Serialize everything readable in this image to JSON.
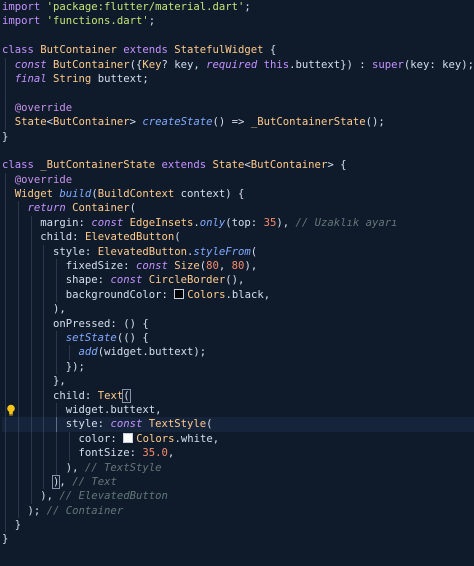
{
  "editor": {
    "background": "#0f1a2b",
    "current_line": 29,
    "lines": [
      {
        "tokens": [
          {
            "t": "import ",
            "c": "kw"
          },
          {
            "t": "'package:flutter/material.dart'",
            "c": "str"
          },
          {
            "t": ";",
            "c": "pl"
          }
        ]
      },
      {
        "tokens": [
          {
            "t": "import ",
            "c": "kw"
          },
          {
            "t": "'functions.dart'",
            "c": "str"
          },
          {
            "t": ";",
            "c": "pl"
          }
        ]
      },
      {
        "tokens": []
      },
      {
        "tokens": [
          {
            "t": "class ",
            "c": "kw"
          },
          {
            "t": "ButContainer ",
            "c": "cls"
          },
          {
            "t": "extends ",
            "c": "kw"
          },
          {
            "t": "StatefulWidget ",
            "c": "cls"
          },
          {
            "t": "{",
            "c": "pl"
          }
        ]
      },
      {
        "guides": [
          0
        ],
        "tokens": [
          {
            "t": "  ",
            "c": "pl"
          },
          {
            "t": "const ",
            "c": "kwi"
          },
          {
            "t": "ButContainer",
            "c": "cls"
          },
          {
            "t": "({",
            "c": "pl"
          },
          {
            "t": "Key",
            "c": "cls"
          },
          {
            "t": "? ",
            "c": "pl"
          },
          {
            "t": "key",
            "c": "pl"
          },
          {
            "t": ", ",
            "c": "pl"
          },
          {
            "t": "required ",
            "c": "kwi"
          },
          {
            "t": "this",
            "c": "kw"
          },
          {
            "t": ".buttext",
            "c": "pl"
          },
          {
            "t": "}) : ",
            "c": "pl"
          },
          {
            "t": "super",
            "c": "kw"
          },
          {
            "t": "(key: key);",
            "c": "pl"
          }
        ]
      },
      {
        "guides": [
          0
        ],
        "tokens": [
          {
            "t": "  ",
            "c": "pl"
          },
          {
            "t": "final ",
            "c": "kwi"
          },
          {
            "t": "String ",
            "c": "cls"
          },
          {
            "t": "buttext;",
            "c": "pl"
          }
        ]
      },
      {
        "guides": [
          0
        ],
        "tokens": []
      },
      {
        "guides": [
          0
        ],
        "tokens": [
          {
            "t": "  ",
            "c": "pl"
          },
          {
            "t": "@override",
            "c": "ann"
          }
        ]
      },
      {
        "guides": [
          0
        ],
        "tokens": [
          {
            "t": "  ",
            "c": "pl"
          },
          {
            "t": "State",
            "c": "cls"
          },
          {
            "t": "<",
            "c": "pl"
          },
          {
            "t": "ButContainer",
            "c": "cls"
          },
          {
            "t": "> ",
            "c": "pl"
          },
          {
            "t": "createState",
            "c": "fn"
          },
          {
            "t": "() => ",
            "c": "pl"
          },
          {
            "t": "_ButContainerState",
            "c": "cls"
          },
          {
            "t": "();",
            "c": "pl"
          }
        ]
      },
      {
        "tokens": [
          {
            "t": "}",
            "c": "pl"
          }
        ]
      },
      {
        "tokens": []
      },
      {
        "tokens": [
          {
            "t": "class ",
            "c": "kw"
          },
          {
            "t": "_ButContainerState ",
            "c": "cls"
          },
          {
            "t": "extends ",
            "c": "kw"
          },
          {
            "t": "State",
            "c": "cls"
          },
          {
            "t": "<",
            "c": "pl"
          },
          {
            "t": "ButContainer",
            "c": "cls"
          },
          {
            "t": "> {",
            "c": "pl"
          }
        ]
      },
      {
        "guides": [
          0
        ],
        "tokens": [
          {
            "t": "  ",
            "c": "pl"
          },
          {
            "t": "@override",
            "c": "ann"
          }
        ]
      },
      {
        "guides": [
          0
        ],
        "tokens": [
          {
            "t": "  ",
            "c": "pl"
          },
          {
            "t": "Widget ",
            "c": "cls"
          },
          {
            "t": "build",
            "c": "fn"
          },
          {
            "t": "(",
            "c": "pl"
          },
          {
            "t": "BuildContext ",
            "c": "cls"
          },
          {
            "t": "context) {",
            "c": "pl"
          }
        ]
      },
      {
        "guides": [
          0,
          1
        ],
        "tokens": [
          {
            "t": "    ",
            "c": "pl"
          },
          {
            "t": "return ",
            "c": "kwi"
          },
          {
            "t": "Container",
            "c": "cls"
          },
          {
            "t": "(",
            "c": "pl"
          }
        ]
      },
      {
        "guides": [
          0,
          1,
          2
        ],
        "tokens": [
          {
            "t": "      ",
            "c": "pl"
          },
          {
            "t": "margin: ",
            "c": "pl"
          },
          {
            "t": "const ",
            "c": "kwi"
          },
          {
            "t": "EdgeInsets",
            "c": "cls"
          },
          {
            "t": ".",
            "c": "pl"
          },
          {
            "t": "only",
            "c": "fn"
          },
          {
            "t": "(top: ",
            "c": "pl"
          },
          {
            "t": "35",
            "c": "num"
          },
          {
            "t": "), ",
            "c": "pl"
          },
          {
            "t": "// Uzaklık ayarı",
            "c": "cmt"
          }
        ]
      },
      {
        "guides": [
          0,
          1,
          2
        ],
        "tokens": [
          {
            "t": "      ",
            "c": "pl"
          },
          {
            "t": "child: ",
            "c": "pl"
          },
          {
            "t": "ElevatedButton",
            "c": "cls"
          },
          {
            "t": "(",
            "c": "pl"
          }
        ]
      },
      {
        "guides": [
          0,
          1,
          2,
          3
        ],
        "tokens": [
          {
            "t": "        ",
            "c": "pl"
          },
          {
            "t": "style: ",
            "c": "pl"
          },
          {
            "t": "ElevatedButton",
            "c": "cls"
          },
          {
            "t": ".",
            "c": "pl"
          },
          {
            "t": "styleFrom",
            "c": "fn"
          },
          {
            "t": "(",
            "c": "pl"
          }
        ]
      },
      {
        "guides": [
          0,
          1,
          2,
          3,
          4
        ],
        "tokens": [
          {
            "t": "          ",
            "c": "pl"
          },
          {
            "t": "fixedSize: ",
            "c": "pl"
          },
          {
            "t": "const ",
            "c": "kwi"
          },
          {
            "t": "Size",
            "c": "cls"
          },
          {
            "t": "(",
            "c": "pl"
          },
          {
            "t": "80",
            "c": "num"
          },
          {
            "t": ", ",
            "c": "pl"
          },
          {
            "t": "80",
            "c": "num"
          },
          {
            "t": "),",
            "c": "pl"
          }
        ]
      },
      {
        "guides": [
          0,
          1,
          2,
          3,
          4
        ],
        "tokens": [
          {
            "t": "          ",
            "c": "pl"
          },
          {
            "t": "shape: ",
            "c": "pl"
          },
          {
            "t": "const ",
            "c": "kwi"
          },
          {
            "t": "CircleBorder",
            "c": "cls"
          },
          {
            "t": "(),",
            "c": "pl"
          }
        ]
      },
      {
        "guides": [
          0,
          1,
          2,
          3,
          4
        ],
        "tokens": [
          {
            "t": "          ",
            "c": "pl"
          },
          {
            "t": "backgroundColor: ",
            "c": "pl"
          },
          {
            "swatch": "#000000"
          },
          {
            "t": "Colors",
            "c": "cls"
          },
          {
            "t": ".black,",
            "c": "pl"
          }
        ]
      },
      {
        "guides": [
          0,
          1,
          2,
          3
        ],
        "tokens": [
          {
            "t": "        ",
            "c": "pl"
          },
          {
            "t": "),",
            "c": "pl"
          }
        ]
      },
      {
        "guides": [
          0,
          1,
          2,
          3
        ],
        "tokens": [
          {
            "t": "        ",
            "c": "pl"
          },
          {
            "t": "onPressed: ",
            "c": "pl"
          },
          {
            "t": "() {",
            "c": "pl"
          }
        ]
      },
      {
        "guides": [
          0,
          1,
          2,
          3,
          4
        ],
        "tokens": [
          {
            "t": "          ",
            "c": "pl"
          },
          {
            "t": "setState",
            "c": "fn"
          },
          {
            "t": "(() {",
            "c": "pl"
          }
        ]
      },
      {
        "guides": [
          0,
          1,
          2,
          3,
          4,
          5
        ],
        "tokens": [
          {
            "t": "            ",
            "c": "pl"
          },
          {
            "t": "add",
            "c": "fn"
          },
          {
            "t": "(widget.buttext);",
            "c": "pl"
          }
        ]
      },
      {
        "guides": [
          0,
          1,
          2,
          3,
          4
        ],
        "tokens": [
          {
            "t": "          ",
            "c": "pl"
          },
          {
            "t": "});",
            "c": "pl"
          }
        ]
      },
      {
        "guides": [
          0,
          1,
          2,
          3
        ],
        "tokens": [
          {
            "t": "        ",
            "c": "pl"
          },
          {
            "t": "},",
            "c": "pl"
          }
        ]
      },
      {
        "guides": [
          0,
          1,
          2,
          3
        ],
        "tokens": [
          {
            "t": "        ",
            "c": "pl"
          },
          {
            "t": "child: ",
            "c": "pl"
          },
          {
            "t": "Text",
            "c": "cls"
          },
          {
            "t": "(",
            "c": "pl",
            "match": true
          }
        ]
      },
      {
        "guides": [
          0,
          1,
          2,
          3,
          4
        ],
        "bulb": true,
        "tokens": [
          {
            "t": "          ",
            "c": "pl"
          },
          {
            "t": "widget.buttext,",
            "c": "pl"
          }
        ]
      },
      {
        "guides": [
          0,
          1,
          2,
          3,
          4
        ],
        "tokens": [
          {
            "t": "          ",
            "c": "pl"
          },
          {
            "t": "style: ",
            "c": "pl"
          },
          {
            "t": "const ",
            "c": "kwi"
          },
          {
            "t": "TextStyle",
            "c": "cls"
          },
          {
            "t": "(",
            "c": "pl"
          }
        ]
      },
      {
        "guides": [
          0,
          1,
          2,
          3,
          4,
          5
        ],
        "tokens": [
          {
            "t": "            ",
            "c": "pl"
          },
          {
            "t": "color: ",
            "c": "pl"
          },
          {
            "swatch": "#ffffff"
          },
          {
            "t": "Colors",
            "c": "cls"
          },
          {
            "t": ".white,",
            "c": "pl"
          }
        ]
      },
      {
        "guides": [
          0,
          1,
          2,
          3,
          4,
          5
        ],
        "tokens": [
          {
            "t": "            ",
            "c": "pl"
          },
          {
            "t": "fontSize: ",
            "c": "pl"
          },
          {
            "t": "35.0",
            "c": "num"
          },
          {
            "t": ",",
            "c": "pl"
          }
        ]
      },
      {
        "guides": [
          0,
          1,
          2,
          3,
          4
        ],
        "tokens": [
          {
            "t": "          ",
            "c": "pl"
          },
          {
            "t": "), ",
            "c": "pl"
          },
          {
            "t": "// TextStyle",
            "c": "cmt"
          }
        ]
      },
      {
        "guides": [
          0,
          1,
          2,
          3
        ],
        "tokens": [
          {
            "t": "        ",
            "c": "pl"
          },
          {
            "t": ")",
            "c": "pl",
            "match": true
          },
          {
            "t": ", ",
            "c": "pl"
          },
          {
            "t": "// Text",
            "c": "cmt"
          }
        ]
      },
      {
        "guides": [
          0,
          1,
          2
        ],
        "tokens": [
          {
            "t": "      ",
            "c": "pl"
          },
          {
            "t": "), ",
            "c": "pl"
          },
          {
            "t": "// ElevatedButton",
            "c": "cmt"
          }
        ]
      },
      {
        "guides": [
          0,
          1
        ],
        "tokens": [
          {
            "t": "    ",
            "c": "pl"
          },
          {
            "t": "); ",
            "c": "pl"
          },
          {
            "t": "// Container",
            "c": "cmt"
          }
        ]
      },
      {
        "guides": [
          0
        ],
        "tokens": [
          {
            "t": "  ",
            "c": "pl"
          },
          {
            "t": "}",
            "c": "pl"
          }
        ]
      },
      {
        "tokens": [
          {
            "t": "}",
            "c": "pl"
          }
        ]
      }
    ]
  }
}
